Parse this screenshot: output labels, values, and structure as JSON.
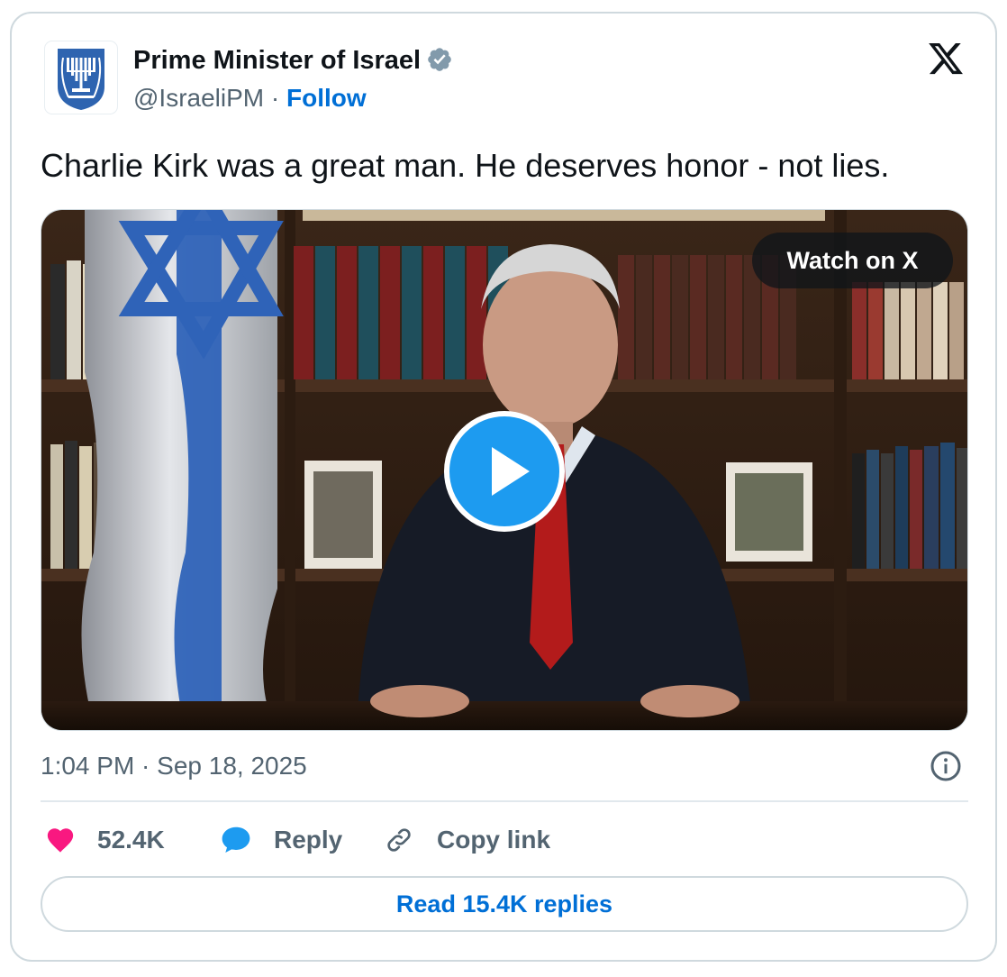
{
  "author": {
    "name": "Prime Minister of Israel",
    "handle": "@IsraeliPM",
    "separator": "·",
    "follow_label": "Follow",
    "verified_color": "#829aab"
  },
  "tweet": {
    "text": "Charlie Kirk was a great man. He deserves honor - not lies.",
    "timestamp": "1:04 PM · Sep 18, 2025"
  },
  "media": {
    "type": "video",
    "watch_label": "Watch on X",
    "play_icon": "play-icon"
  },
  "actions": {
    "likes_count": "52.4K",
    "reply_label": "Reply",
    "copy_link_label": "Copy link",
    "read_replies_label": "Read 15.4K replies"
  },
  "colors": {
    "link_blue": "#006fd6",
    "heart": "#f91880",
    "reply_bubble": "#1d9bf0",
    "muted_text": "#536471",
    "border": "#cfd9de"
  },
  "icons": {
    "brand": "x-logo-icon",
    "avatar": "israel-emblem-icon",
    "verified": "verified-badge-icon",
    "info": "info-icon",
    "like": "heart-icon",
    "reply": "reply-bubble-icon",
    "copy": "link-icon"
  }
}
